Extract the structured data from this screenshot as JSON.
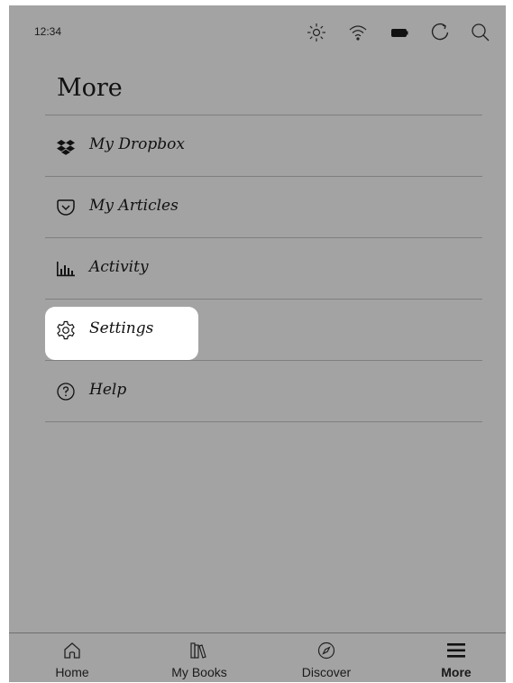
{
  "status_bar": {
    "time": "12:34",
    "icons": [
      "brightness-icon",
      "wifi-icon",
      "battery-icon",
      "sync-icon",
      "search-icon"
    ]
  },
  "page": {
    "title": "More"
  },
  "menu": {
    "items": [
      {
        "label": "My Dropbox",
        "icon": "dropbox-icon"
      },
      {
        "label": "My Articles",
        "icon": "pocket-icon"
      },
      {
        "label": "Activity",
        "icon": "activity-chart-icon"
      },
      {
        "label": "Settings",
        "icon": "gear-icon",
        "highlighted": true
      },
      {
        "label": "Help",
        "icon": "help-icon"
      }
    ]
  },
  "nav": {
    "tabs": [
      {
        "label": "Home",
        "icon": "home-icon"
      },
      {
        "label": "My Books",
        "icon": "books-icon"
      },
      {
        "label": "Discover",
        "icon": "compass-icon"
      },
      {
        "label": "More",
        "icon": "menu-icon",
        "active": true
      }
    ]
  },
  "colors": {
    "screen_bg": "#a3a3a3",
    "highlight_bg": "#ffffff",
    "divider": "#7f7f7f",
    "text": "#111111"
  }
}
